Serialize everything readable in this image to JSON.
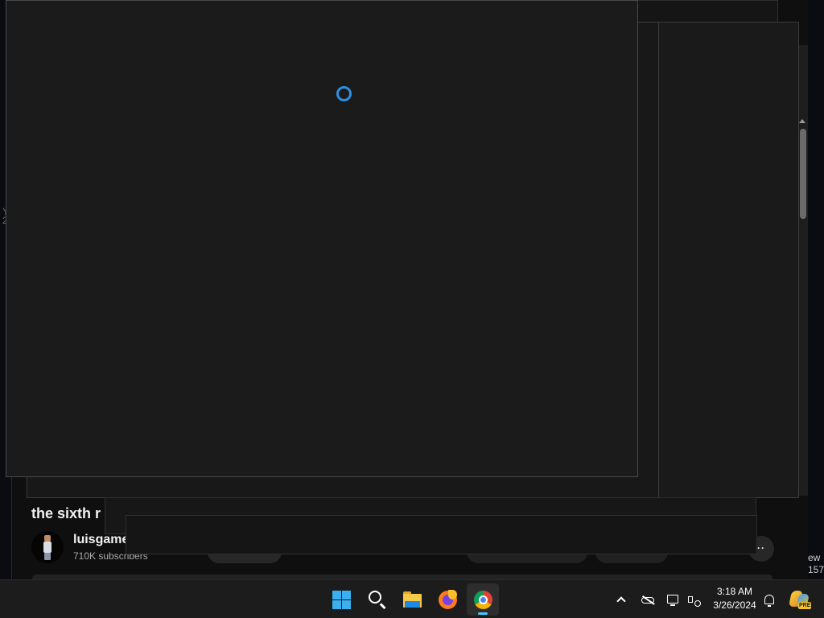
{
  "background_page": {
    "video_title": "the sixth r",
    "channel": {
      "name": "luisgame",
      "subscribers": "710K subscribers"
    },
    "more_label": "··",
    "side_labels": [
      "ew",
      "157"
    ],
    "left_edge_glyph": "Y\n2"
  },
  "loading": {
    "icon": "loading-spinner-icon",
    "color": "#2d8fe3"
  },
  "taskbar": {
    "apps": [
      {
        "name": "Start",
        "icon": "windows-start-icon"
      },
      {
        "name": "Search",
        "icon": "search-icon"
      },
      {
        "name": "File Explorer",
        "icon": "folder-icon"
      },
      {
        "name": "Firefox",
        "icon": "firefox-icon"
      },
      {
        "name": "Google Chrome",
        "icon": "chrome-icon",
        "active": true
      }
    ],
    "tray": {
      "icons": [
        "chevron-up-icon",
        "cloud-offline-icon",
        "network-icon",
        "volume-muted-icon",
        "notification-bell-icon",
        "copilot-icon"
      ],
      "time": "3:18 AM",
      "date": "3/26/2024",
      "copilot_badge": "PRE"
    }
  },
  "colors": {
    "accent": "#4cc2ff",
    "window_bg": "#1b1b1b",
    "taskbar_bg": "#1c1c1c"
  }
}
